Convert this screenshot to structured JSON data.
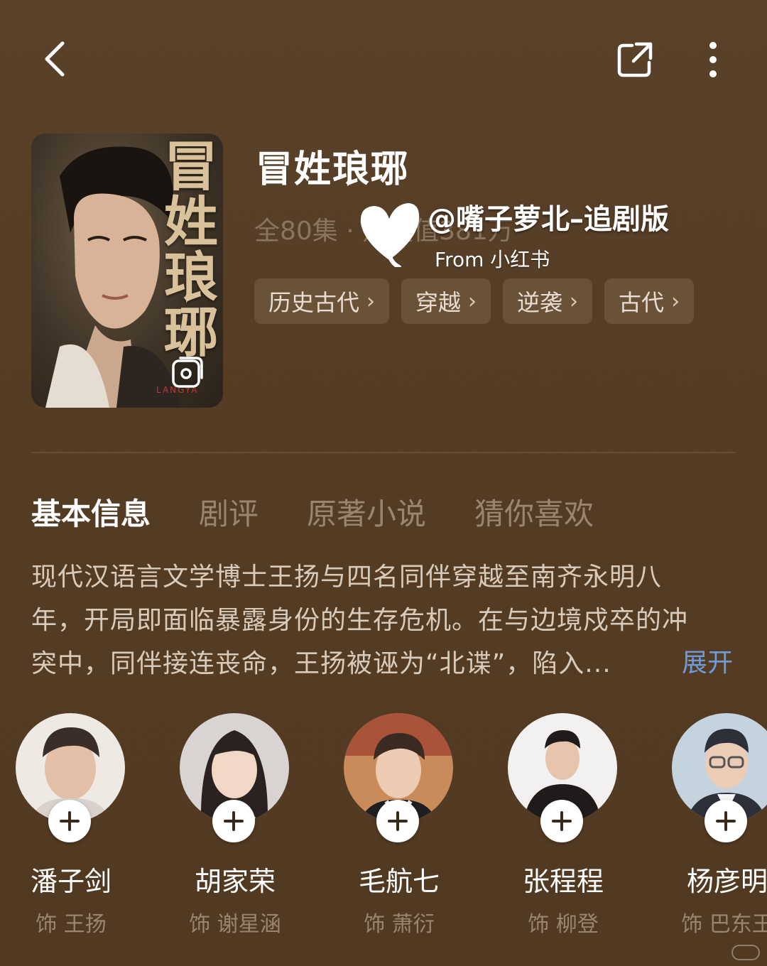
{
  "topbar": {
    "back_icon": "chevron-left-icon",
    "share_icon": "share-external-icon",
    "more_icon": "more-vertical-icon"
  },
  "drama": {
    "poster_art_title": "冒姓琅琊",
    "poster_subtitle": "LANGYA",
    "title": "冒姓琅琊",
    "meta": "全80集 · 热度值381万",
    "tags": [
      {
        "label": "历史古代"
      },
      {
        "label": "穿越"
      },
      {
        "label": "逆袭"
      },
      {
        "label": "古代"
      }
    ]
  },
  "watermark": {
    "handle": "@嘴子萝北–追剧版",
    "from": "From 小红书"
  },
  "tabs": [
    {
      "label": "基本信息",
      "active": true
    },
    {
      "label": "剧评",
      "active": false
    },
    {
      "label": "原著小说",
      "active": false
    },
    {
      "label": "猜你喜欢",
      "active": false
    }
  ],
  "description": {
    "lines": [
      "现代汉语言文学博士王扬与四名同伴穿越至南齐永明八",
      "年，开局即面临暴露身份的生存危机。在与边境戍卒的冲",
      "突中，同伴接连丧命，王扬被诬为“北谍”，陷入..."
    ],
    "expand_label": "展开"
  },
  "cast": [
    {
      "name": "潘子剑",
      "role": "饰 王扬",
      "palette": [
        "#efe9e4",
        "#3a2e2a"
      ]
    },
    {
      "name": "胡家荣",
      "role": "饰 谢星涵",
      "palette": [
        "#d9d4d1",
        "#2b2220"
      ]
    },
    {
      "name": "毛航七",
      "role": "饰 萧衍",
      "palette": [
        "#c98b5a",
        "#3a2a22"
      ]
    },
    {
      "name": "张程程",
      "role": "饰 柳登",
      "palette": [
        "#f3f1ef",
        "#1f1b1a"
      ]
    },
    {
      "name": "杨彦明",
      "role": "饰 巴东王",
      "palette": [
        "#c4d3de",
        "#2d3038"
      ]
    }
  ]
}
